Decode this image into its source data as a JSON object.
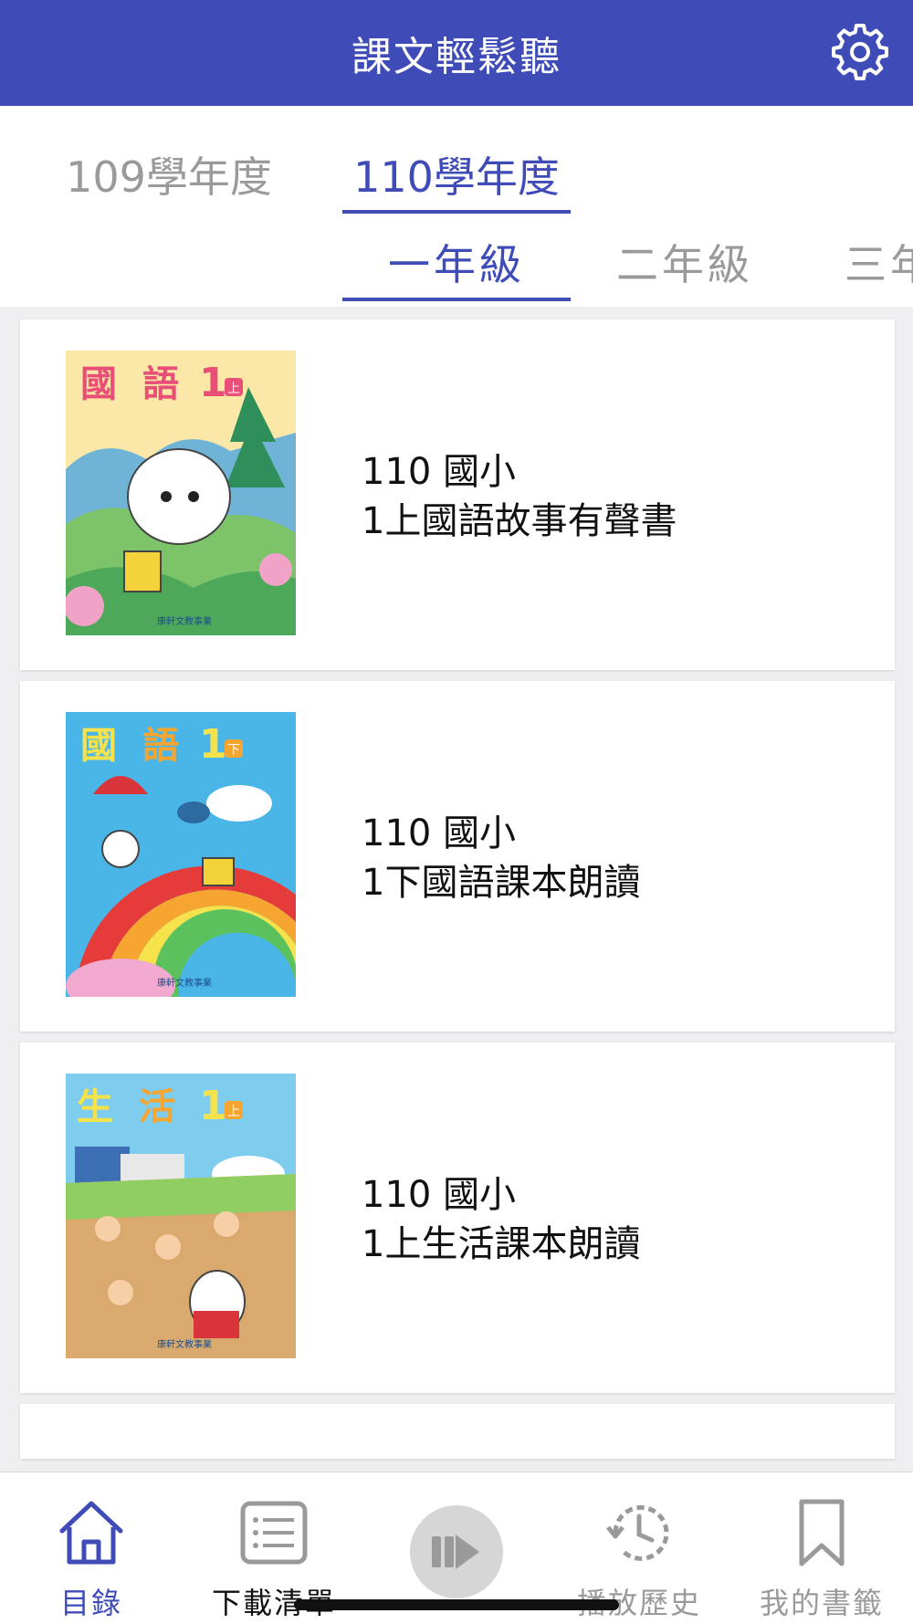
{
  "header": {
    "title": "課文輕鬆聽",
    "settings_icon": "gear-icon"
  },
  "year_tabs": [
    {
      "label": "109學年度",
      "active": false
    },
    {
      "label": "110學年度",
      "active": true
    }
  ],
  "grade_tabs": [
    {
      "label": "一年級",
      "active": true
    },
    {
      "label": "二年級",
      "active": false
    },
    {
      "label": "三年級",
      "active": false
    }
  ],
  "books": [
    {
      "line1": "110 國小",
      "line2": "1上國語故事有聲書",
      "cover_title": "國語",
      "cover_grade": "1",
      "cover_term": "上"
    },
    {
      "line1": "110 國小",
      "line2": "1下國語課本朗讀",
      "cover_title": "國語",
      "cover_grade": "1",
      "cover_term": "下"
    },
    {
      "line1": "110 國小",
      "line2": "1上生活課本朗讀",
      "cover_title": "生活",
      "cover_grade": "1",
      "cover_term": "上"
    }
  ],
  "publisher": "康軒文教事業",
  "bottom_nav": [
    {
      "label": "目錄",
      "icon": "home-icon",
      "active": true
    },
    {
      "label": "下載清單",
      "icon": "list-icon",
      "active": false
    },
    {
      "label": "播放歷史",
      "icon": "history-icon",
      "active": false
    },
    {
      "label": "我的書籤",
      "icon": "bookmark-icon",
      "active": false
    }
  ],
  "player": {
    "icon": "play-pause-icon"
  },
  "colors": {
    "primary": "#3f4cb8",
    "inactive": "#9a9a9a",
    "background": "#efeff2"
  }
}
